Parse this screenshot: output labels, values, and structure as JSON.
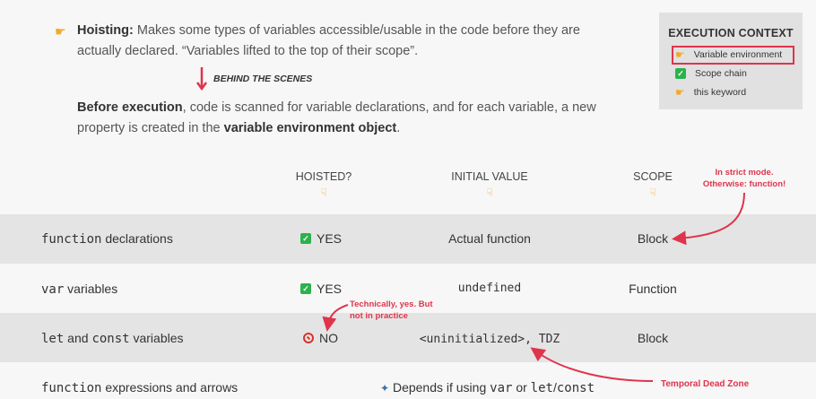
{
  "execution_context": {
    "title": "EXECUTION CONTEXT",
    "items": [
      {
        "label": "Variable environment",
        "icon": "hand-pointing-icon"
      },
      {
        "label": "Scope chain",
        "icon": "check-icon"
      },
      {
        "label": "this keyword",
        "icon": "hand-pointing-icon"
      }
    ]
  },
  "intro": {
    "hoisting_label": "Hoisting:",
    "hoisting_text_1": "Makes some types of variables accessible/usable in the code before they are",
    "hoisting_text_2": "actually declared. “Variables lifted to the top of their scope”.",
    "behind_label": "BEHIND THE SCENES",
    "before_label": "Before execution",
    "before_text_1": ", code is scanned for variable declarations, and for each variable, a new",
    "before_text_2_a": "property is created in the ",
    "before_text_2_b": "variable environment object",
    "before_text_2_c": "."
  },
  "columns": {
    "hoisted": "HOISTED?",
    "initial": "INITIAL VALUE",
    "scope": "SCOPE"
  },
  "rows": [
    {
      "kw": "function",
      "rest": " declarations",
      "hoisted": "YES",
      "initial": "Actual function",
      "scope": "Block"
    },
    {
      "kw": "var",
      "rest": " variables",
      "hoisted": "YES",
      "initial": "undefined",
      "scope": "Function"
    },
    {
      "kw": "let",
      "mid": " and ",
      "kw2": "const",
      "rest": " variables",
      "hoisted": "NO",
      "initial": "<uninitialized>, TDZ",
      "scope": "Block"
    },
    {
      "kw": "function",
      "rest": " expressions and arrows",
      "depends_a": "Depends if using ",
      "depends_var": "var",
      "depends_b": " or ",
      "depends_let": "let",
      "depends_sep": "/",
      "depends_const": "const"
    }
  ],
  "notes": {
    "strict_1": "In strict mode.",
    "strict_2": "Otherwise: function!",
    "tech_1": "Technically, yes. But",
    "tech_2": "not in practice",
    "tdz": "Temporal Dead Zone"
  },
  "colors": {
    "accent_red": "#e0344c",
    "check_green": "#2bb24c",
    "hand_yellow": "#f2a92c"
  }
}
